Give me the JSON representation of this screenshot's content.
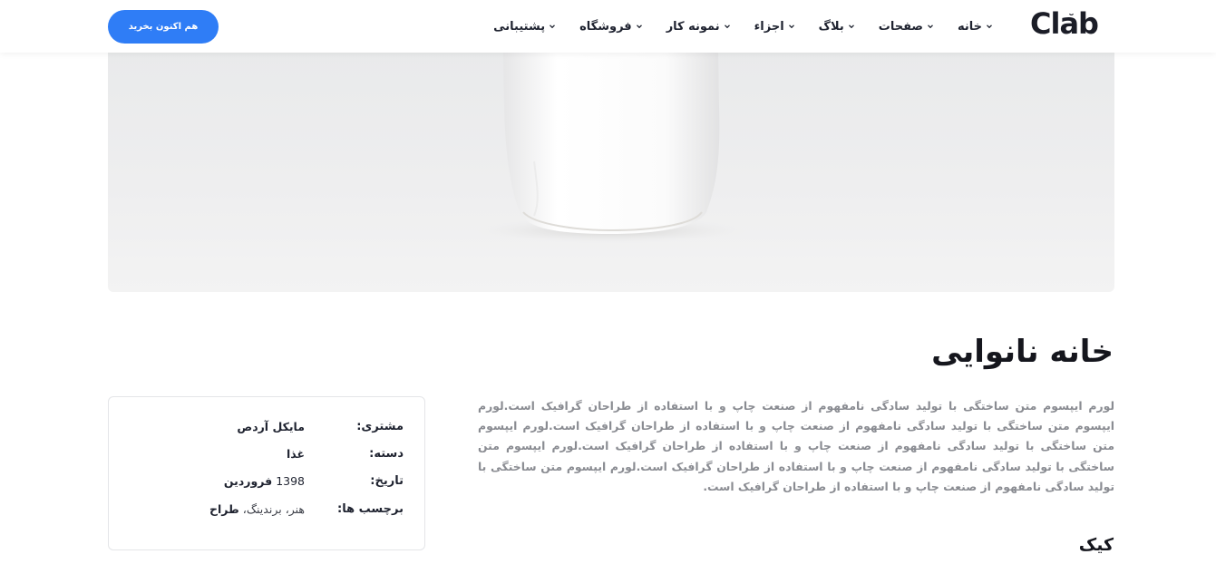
{
  "header": {
    "logo": "Clab",
    "logo_accent": "˘",
    "cta_label": "هم اکنون بخرید",
    "nav": [
      {
        "label": "خانه",
        "has_dropdown": true
      },
      {
        "label": "صفحات",
        "has_dropdown": true
      },
      {
        "label": "بلاگ",
        "has_dropdown": true
      },
      {
        "label": "اجزاء",
        "has_dropdown": true
      },
      {
        "label": "نمونه کار",
        "has_dropdown": true
      },
      {
        "label": "فروشگاه",
        "has_dropdown": true
      },
      {
        "label": "پشتیبانی",
        "has_dropdown": true
      }
    ]
  },
  "project": {
    "title": "خانه نانوایی",
    "description": "لورم ایپسوم متن ساختگی با تولید سادگی نامفهوم از صنعت چاپ و با استفاده از طراحان گرافیک است.لورم ایپسوم متن ساختگی با تولید سادگی نامفهوم از صنعت چاپ و با استفاده از طراحان گرافیک است.لورم ایپسوم متن ساختگی با تولید سادگی نامفهوم از صنعت چاپ و با استفاده از طراحان گرافیک است.لورم ایپسوم متن ساختگی با تولید سادگی نامفهوم از صنعت چاپ و با استفاده از طراحان گرافیک است.لورم ایپسوم متن ساختگی با تولید سادگی نامفهوم از صنعت چاپ و با استفاده از طراحان گرافیک است.",
    "subheading": "کیک"
  },
  "info": {
    "client_label": "مشتری:",
    "client_value": "مایکل آردص",
    "category_label": "دسته:",
    "category_value": "غذا",
    "date_label": "تاریخ:",
    "date_year": "1398",
    "date_month": "فروردین",
    "tags_label": "برچسب ها:",
    "tag_1": "هنر",
    "tag_2": "برندینگ",
    "tag_3": "طراح",
    "tag_separator": "،"
  },
  "colors": {
    "accent": "#2f7df6",
    "text": "#1f2330",
    "muted": "#8a8c92"
  }
}
